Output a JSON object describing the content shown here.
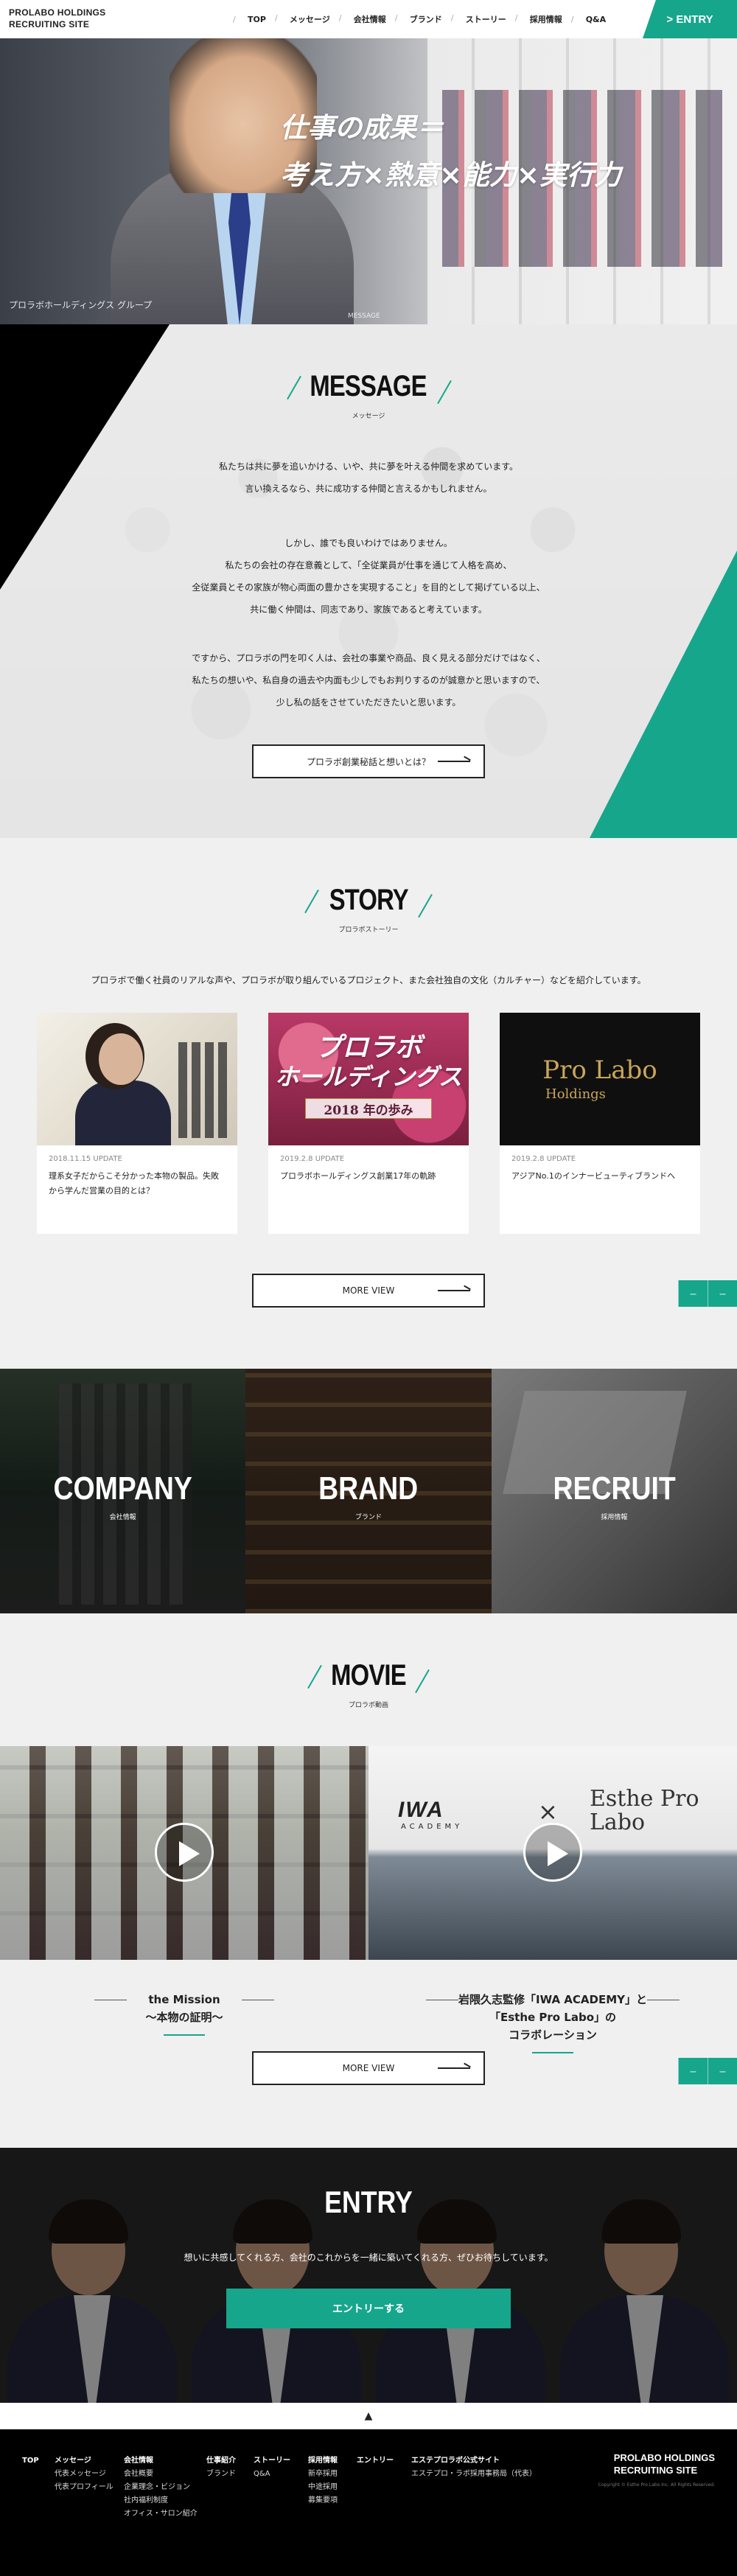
{
  "header": {
    "logo_line1": "PROLABO HOLDINGS",
    "logo_line2": "RECRUITING SITE",
    "nav": [
      "TOP",
      "メッセージ",
      "会社情報",
      "ブランド",
      "ストーリー",
      "採用情報",
      "Q&A"
    ],
    "entry_label": "> ENTRY"
  },
  "hero": {
    "catch_line1": "仕事の成果＝",
    "catch_line2": "考え方×熱意×能力×実行力",
    "caption": "プロラボホールディングス グループ",
    "small": "MESSAGE"
  },
  "message": {
    "title": "MESSAGE",
    "subtitle": "メッセージ",
    "p1_l1": "私たちは共に夢を追いかける、いや、共に夢を叶える仲間を求めています。",
    "p1_l2": "言い換えるなら、共に成功する仲間と言えるかもしれません。",
    "p2_l1": "しかし、誰でも良いわけではありません。",
    "p2_l2": "私たちの会社の存在意義として、「全従業員が仕事を通じて人格を高め、",
    "p2_l3": "全従業員とその家族が物心両面の豊かさを実現すること」を目的として掲げている以上、",
    "p2_l4": "共に働く仲間は、同志であり、家族であると考えています。",
    "p3_l1": "ですから、プロラボの門を叩く人は、会社の事業や商品、良く見える部分だけではなく、",
    "p3_l2": "私たちの想いや、私自身の過去や内面も少しでもお判りするのが誠意かと思いますので、",
    "p3_l3": "少し私の話をさせていただきたいと思います。",
    "button": "プロラボ創業秘話と想いとは？"
  },
  "story": {
    "title": "STORY",
    "subtitle": "プロラボストーリー",
    "lead": "プロラボで働く社員のリアルな声や、プロラボが取り組んでいるプロジェクト、また会社独自の文化（カルチャー）などを紹介しています。",
    "cards": [
      {
        "date": "2018.11.15 UPDATE",
        "title": "理系女子だからこそ分かった本物の製品。失敗から学んだ営業の目的とは？"
      },
      {
        "date": "2019.2.8 UPDATE",
        "title": "プロラボホールディングス創業17年の軌跡",
        "thumb_line1": "プロラボ",
        "thumb_line2": "ホールディングス",
        "thumb_bar": "2018 年の歩み"
      },
      {
        "date": "2019.2.8 UPDATE",
        "title": "アジアNo.1のインナービューティブランドへ",
        "thumb_line1": "Pro Labo",
        "thumb_line2": "Holdings"
      }
    ],
    "more": "MORE VIEW"
  },
  "tiles": [
    {
      "label": "COMPANY",
      "sub": "会社情報"
    },
    {
      "label": "BRAND",
      "sub": "ブランド"
    },
    {
      "label": "RECRUIT",
      "sub": "採用情報"
    }
  ],
  "movie": {
    "title": "MOVIE",
    "subtitle": "プロラボ動画",
    "v1_title_l1": "the Mission",
    "v1_title_l2": "〜本物の証明〜",
    "v2_title_l1": "岩隈久志監修「IWA ACADEMY」と",
    "v2_title_l2": "「Esthe Pro Labo」の",
    "v2_title_l3": "コラボレーション",
    "v2_iwa": "IWA",
    "v2_iwa_sub": "ACADEMY",
    "v2_x": "×",
    "v2_esthe_l1": "Esthe Pro",
    "v2_esthe_l2": "Labo",
    "more": "MORE VIEW"
  },
  "side_tab": {
    "a": "ー",
    "b": "ー"
  },
  "entry": {
    "title": "ENTRY",
    "lead": "想いに共感してくれる方、会社のこれからを一緒に築いてくれる方、ぜひお待ちしています。",
    "cta": "エントリーする"
  },
  "pagetop": "▲",
  "footer": {
    "col1": [
      "TOP"
    ],
    "col2": [
      "メッセージ",
      "代表メッセージ",
      "代表プロフィール"
    ],
    "col3": [
      "会社情報",
      "会社概要",
      "企業理念・ビジョン",
      "社内福利制度",
      "オフィス・サロン紹介"
    ],
    "col4": [
      "仕事紹介",
      "ブランド"
    ],
    "col5": [
      "ストーリー",
      "Q&A"
    ],
    "col6": [
      "採用情報",
      "新卒採用",
      "中途採用",
      "募集要項"
    ],
    "col7": [
      "エントリー"
    ],
    "col8": [
      "エステプロラボ公式サイト",
      "エステプロ・ラボ採用事務局（代表）"
    ],
    "logo_line1": "PROLABO HOLDINGS",
    "logo_line2": "RECRUITING SITE",
    "copyright": "Copyright © Esthe Pro Labo Inc. All Rights Reserved."
  },
  "colors": {
    "accent": "#16a68c",
    "dark": "#000000"
  }
}
